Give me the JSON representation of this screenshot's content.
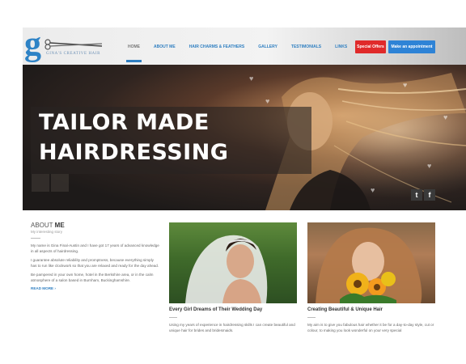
{
  "brand": {
    "logo_letter": "g",
    "logo_text": "GINA'S CREATIVE HAIR",
    "accent": "#2f7fc1"
  },
  "nav": {
    "items": [
      {
        "label": "HOME"
      },
      {
        "label": "ABOUT ME"
      },
      {
        "label": "HAIR CHARMS & FEATHERS"
      },
      {
        "label": "GALLERY"
      },
      {
        "label": "TESTIMONIALS"
      },
      {
        "label": "LINKS"
      }
    ],
    "offers_label": "Special Offers",
    "appointment_label": "Make an appointment",
    "offers_color": "#e02a2a",
    "appointment_color": "#2e83d6"
  },
  "hero": {
    "title_line1": "TAILOR MADE",
    "title_line2": "HAIRDRESSING",
    "social": [
      {
        "icon": "twitter-icon",
        "glyph": "t"
      },
      {
        "icon": "facebook-icon",
        "glyph": "f"
      }
    ]
  },
  "about": {
    "title_light": "ABOUT",
    "title_bold": "ME",
    "subtitle": "My interesting story",
    "paragraphs": [
      "My name is Gina Final-Austin and I have got 17 years of advanced knowledge in all aspects of hairdressing.",
      "I guarantee absolute reliability and promptness, because everything simply has to run like clockwork so that you are relaxed and ready for the day ahead.",
      "Be pampered in your own home, hotel in the Berkshire area, or in the calm atmosphere of a salon based in Burnham, Buckinghamshire."
    ],
    "read_more": "READ MORE ›"
  },
  "cards": [
    {
      "title": "Every Girl Dreams of Their Wedding Day",
      "text": "Using my years of experience in hairdressing skills I can create beautiful and unique hair for brides and bridesmaids."
    },
    {
      "title": "Creating Beautiful & Unique Hair",
      "text": "My aim is to give you fabulous hair whether it be for a day-to-day style, cut or colour, to making you look wonderful on your very special"
    }
  ]
}
